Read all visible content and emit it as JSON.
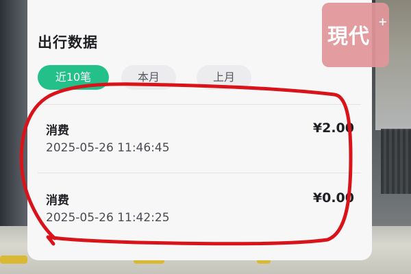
{
  "card": {
    "title": "出行数据"
  },
  "tabs": [
    {
      "label": "近10笔",
      "active": true
    },
    {
      "label": "本月",
      "active": false
    },
    {
      "label": "上月",
      "active": false
    }
  ],
  "records": [
    {
      "type": "消费",
      "time": "2025-05-26 11:46:45",
      "amount": "¥2.00"
    },
    {
      "type": "消费",
      "time": "2025-05-26 11:42:25",
      "amount": "¥0.00"
    }
  ],
  "watermark": {
    "text": "現代",
    "plus": "+"
  },
  "colors": {
    "accent_green": "#23c08a",
    "annotation_red": "#d8141a",
    "logo_pink": "#e2969a"
  }
}
